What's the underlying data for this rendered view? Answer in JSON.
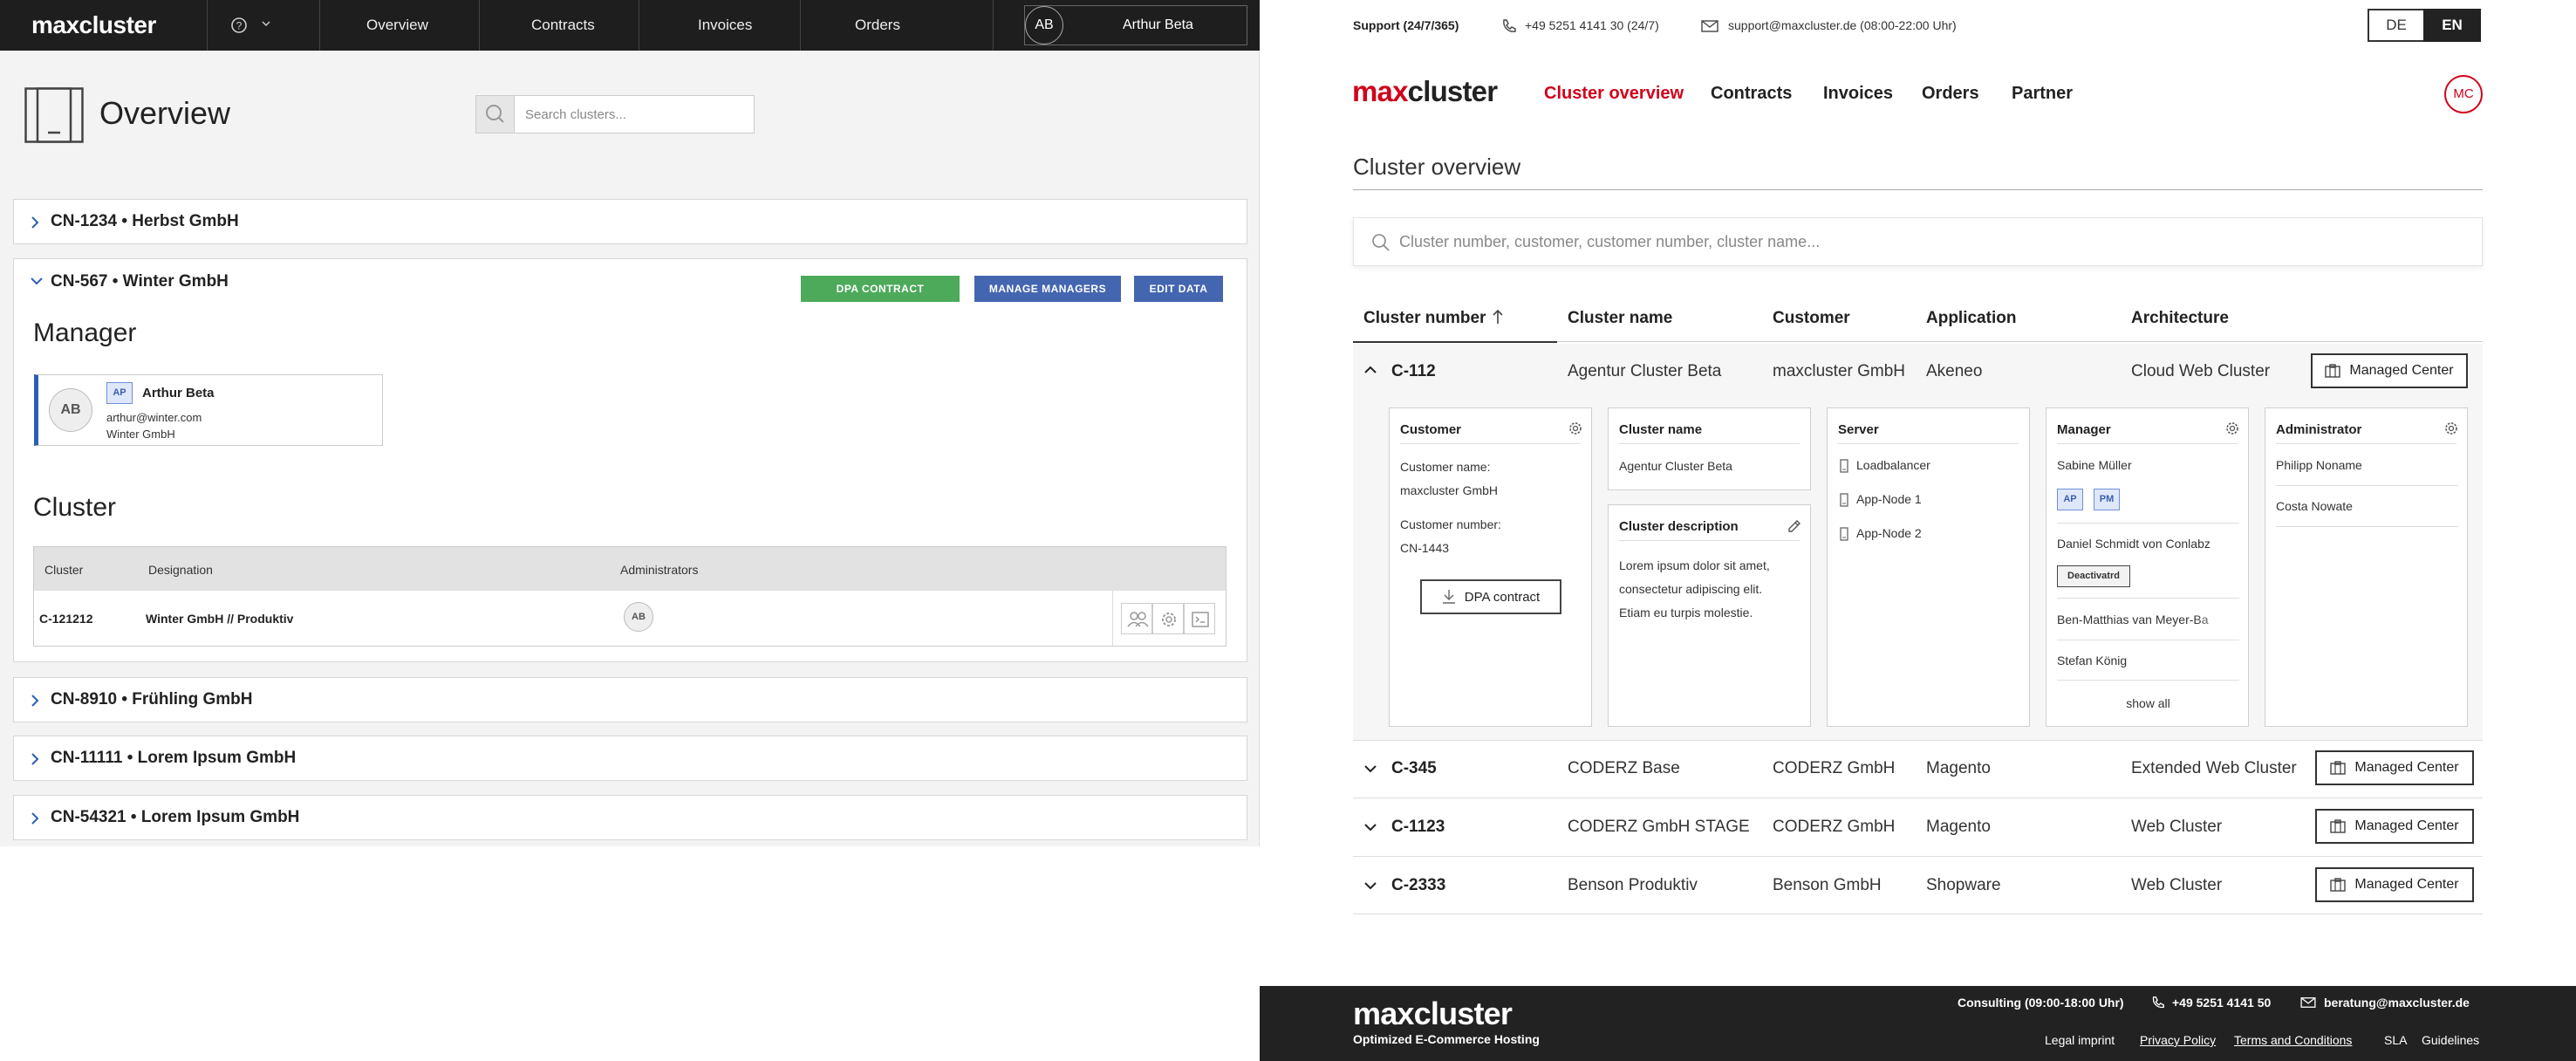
{
  "left": {
    "logo": "maxcluster",
    "nav": [
      "Overview",
      "Contracts",
      "Invoices",
      "Orders"
    ],
    "user": {
      "initials": "AB",
      "name": "Arthur Beta"
    },
    "page_title": "Overview",
    "search_placeholder": "Search clusters...",
    "accordions": [
      "CN-1234 • Herbst GmbH",
      "CN-567 • Winter GmbH",
      "CN-8910 • Frühling GmbH",
      "CN-11111 • Lorem Ipsum GmbH",
      "CN-54321 • Lorem Ipsum GmbH"
    ],
    "buttons": {
      "dpa": "DPA CONTRACT",
      "managers": "MANAGE MANAGERS",
      "edit": "EDIT DATA"
    },
    "colors": {
      "dpa": "#4caa5a",
      "managers": "#4466b0",
      "edit": "#4466b0",
      "nav_bg": "#1e1e1e"
    },
    "manager_heading": "Manager",
    "manager": {
      "initials": "AB",
      "tag": "AP",
      "name": "Arthur Beta",
      "email": "arthur@winter.com",
      "company": "Winter GmbH"
    },
    "cluster_heading": "Cluster",
    "table": {
      "headers": [
        "Cluster",
        "Designation",
        "Administrators"
      ],
      "row": {
        "cluster": "C-121212",
        "designation": "Winter GmbH // Produktiv",
        "admin_initials": "AB"
      }
    }
  },
  "right": {
    "support": {
      "label": "Support (24/7/365)",
      "phone": "+49 5251 4141 30 (24/7)",
      "email": "support@maxcluster.de (08:00-22:00 Uhr)"
    },
    "lang": [
      "DE",
      "EN"
    ],
    "logo": {
      "max": "max",
      "cluster": "cluster"
    },
    "nav": [
      "Cluster overview",
      "Contracts",
      "Invoices",
      "Orders",
      "Partner"
    ],
    "avatar": "MC",
    "accent": "#d0021b",
    "title": "Cluster overview",
    "search_placeholder": "Cluster number, customer, customer number, cluster name...",
    "table_headers": [
      "Cluster number",
      "Cluster name",
      "Customer",
      "Application",
      "Architecture"
    ],
    "rows": [
      {
        "number": "C-112",
        "name": "Agentur Cluster Beta",
        "customer": "maxcluster GmbH",
        "application": "Akeneo",
        "architecture": "Cloud Web Cluster",
        "action": "Managed Center"
      },
      {
        "number": "C-345",
        "name": "CODERZ Base",
        "customer": "CODERZ GmbH",
        "application": "Magento",
        "architecture": "Extended Web Cluster",
        "action": "Managed Center"
      },
      {
        "number": "C-1123",
        "name": "CODERZ GmbH STAGE",
        "customer": "CODERZ GmbH",
        "application": "Magento",
        "architecture": "Web Cluster",
        "action": "Managed Center"
      },
      {
        "number": "C-2333",
        "name": "Benson Produktiv",
        "customer": "Benson GmbH",
        "application": "Shopware",
        "architecture": "Web Cluster",
        "action": "Managed Center"
      }
    ],
    "cards": {
      "customer": {
        "title": "Customer",
        "name_label": "Customer name:",
        "name": "maxcluster GmbH",
        "number_label": "Customer number:",
        "number": "CN-1443",
        "dpa": "DPA contract"
      },
      "cluster_name": {
        "title": "Cluster name",
        "value": "Agentur Cluster Beta"
      },
      "description": {
        "title": "Cluster description",
        "l1": "Lorem ipsum dolor sit amet,",
        "l2": "consectetur adipiscing elit.",
        "l3": "Etiam eu turpis molestie."
      },
      "server": {
        "title": "Server",
        "items": [
          "Loadbalancer",
          "App-Node 1",
          "App-Node 2"
        ]
      },
      "manager": {
        "title": "Manager",
        "m1": "Sabine Müller",
        "tag1": "AP",
        "tag2": "PM",
        "m2": "Daniel Schmidt von Conlabz",
        "deactivated": "Deactivatrd",
        "m3": "Ben-Matthias van Meyer-Ba",
        "m4": "Stefan König",
        "show_all": "show all"
      },
      "admin": {
        "title": "Administrator",
        "a1": "Philipp Noname",
        "a2": "Costa Nowate"
      }
    },
    "footer": {
      "logo": "maxcluster",
      "tagline": "Optimized E-Commerce Hosting",
      "consulting": "Consulting (09:00-18:00 Uhr)",
      "phone": "+49 5251 4141 50",
      "email": "beratung@maxcluster.de",
      "links": [
        "Legal imprint",
        "Privacy Policy",
        "Terms and Conditions",
        "SLA",
        "Guidelines"
      ]
    }
  }
}
